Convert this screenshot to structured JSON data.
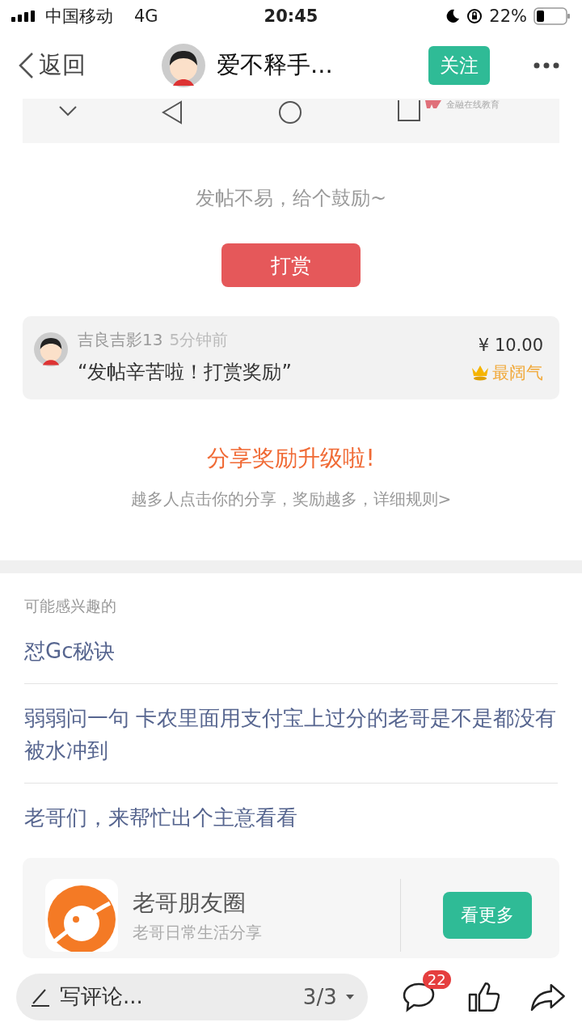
{
  "status_bar": {
    "carrier": "中国移动",
    "network": "4G",
    "time": "20:45",
    "battery": "22%"
  },
  "nav": {
    "back": "返回",
    "title": "爱不释手...",
    "follow": "关注"
  },
  "post_image": {
    "logo_text": "金融在线教育"
  },
  "reward": {
    "prompt": "发帖不易，给个鼓励~",
    "button": "打赏"
  },
  "tips": [
    {
      "user": "吉良吉影13",
      "time": "5分钟前",
      "message": "“发帖辛苦啦！打赏奖励”",
      "amount": "¥ 10.00",
      "badge": "最阔气"
    }
  ],
  "share": {
    "title": "分享奖励升级啦!",
    "subtitle": "越多人点击你的分享，奖励越多，详细规则>"
  },
  "related": {
    "heading": "可能感兴趣的",
    "items": [
      "怼Gc秘诀",
      "弱弱问一句 卡农里面用支付宝上过分的老哥是不是都没有被水冲到",
      "老哥们，来帮忙出个主意看看"
    ]
  },
  "promo": {
    "name": "老哥朋友圈",
    "subtitle": "老哥日常生活分享",
    "button": "看更多"
  },
  "bottom_bar": {
    "placeholder": "写评论...",
    "page": "3/3",
    "comment_count": "22"
  }
}
